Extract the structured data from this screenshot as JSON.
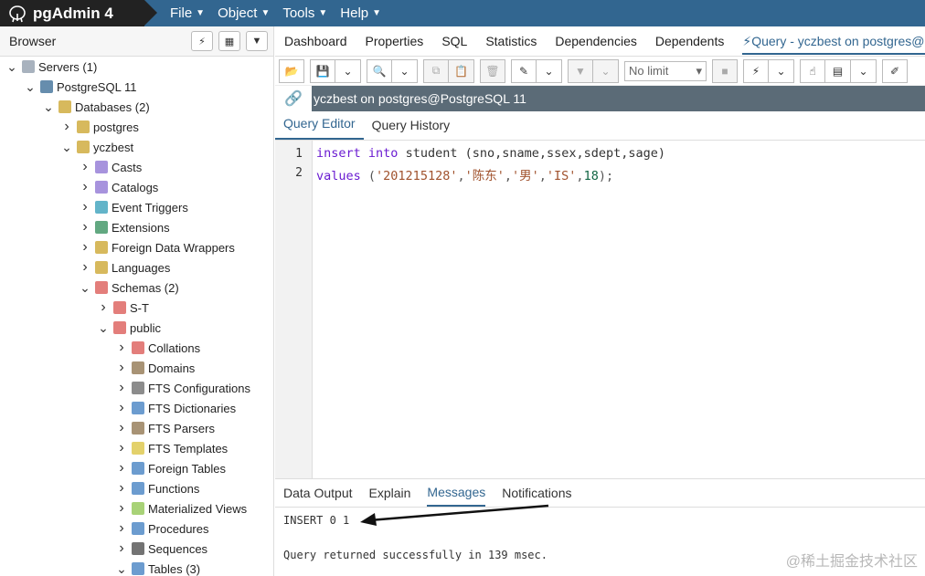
{
  "app": {
    "name": "pgAdmin 4"
  },
  "menu": [
    {
      "label": "File"
    },
    {
      "label": "Object"
    },
    {
      "label": "Tools"
    },
    {
      "label": "Help"
    }
  ],
  "browser": {
    "title": "Browser",
    "tree": [
      {
        "label": "Servers (1)",
        "expanded": true,
        "icon": "servers-icon"
      },
      {
        "label": "PostgreSQL 11",
        "expanded": true,
        "icon": "elephant-icon"
      },
      {
        "label": "Databases (2)",
        "expanded": true,
        "icon": "databases-icon"
      },
      {
        "label": "postgres",
        "expanded": false,
        "icon": "database-icon"
      },
      {
        "label": "yczbest",
        "expanded": true,
        "icon": "database-icon"
      },
      {
        "label": "Casts",
        "expanded": false,
        "icon": "casts-icon"
      },
      {
        "label": "Catalogs",
        "expanded": false,
        "icon": "catalogs-icon"
      },
      {
        "label": "Event Triggers",
        "expanded": false,
        "icon": "event-triggers-icon"
      },
      {
        "label": "Extensions",
        "expanded": false,
        "icon": "extensions-icon"
      },
      {
        "label": "Foreign Data Wrappers",
        "expanded": false,
        "icon": "fdw-icon"
      },
      {
        "label": "Languages",
        "expanded": false,
        "icon": "languages-icon"
      },
      {
        "label": "Schemas (2)",
        "expanded": true,
        "icon": "schemas-icon"
      },
      {
        "label": "S-T",
        "expanded": false,
        "icon": "schema-icon"
      },
      {
        "label": "public",
        "expanded": true,
        "icon": "schema-icon"
      },
      {
        "label": "Collations",
        "expanded": false,
        "icon": "collations-icon"
      },
      {
        "label": "Domains",
        "expanded": false,
        "icon": "domains-icon"
      },
      {
        "label": "FTS Configurations",
        "expanded": false,
        "icon": "fts-config-icon"
      },
      {
        "label": "FTS Dictionaries",
        "expanded": false,
        "icon": "fts-dict-icon"
      },
      {
        "label": "FTS Parsers",
        "expanded": false,
        "icon": "fts-parser-icon"
      },
      {
        "label": "FTS Templates",
        "expanded": false,
        "icon": "fts-template-icon"
      },
      {
        "label": "Foreign Tables",
        "expanded": false,
        "icon": "foreign-tables-icon"
      },
      {
        "label": "Functions",
        "expanded": false,
        "icon": "functions-icon"
      },
      {
        "label": "Materialized Views",
        "expanded": false,
        "icon": "mat-views-icon"
      },
      {
        "label": "Procedures",
        "expanded": false,
        "icon": "procedures-icon"
      },
      {
        "label": "Sequences",
        "expanded": false,
        "icon": "sequences-icon"
      },
      {
        "label": "Tables (3)",
        "expanded": true,
        "icon": "tables-icon"
      }
    ]
  },
  "tabs": [
    {
      "label": "Dashboard"
    },
    {
      "label": "Properties"
    },
    {
      "label": "SQL"
    },
    {
      "label": "Statistics"
    },
    {
      "label": "Dependencies"
    },
    {
      "label": "Dependents"
    },
    {
      "label": "Query - yczbest on postgres@P"
    }
  ],
  "toolbar": {
    "limit_value": "No limit"
  },
  "connection": {
    "label": "yczbest on postgres@PostgreSQL 11"
  },
  "query_tabs": [
    {
      "label": "Query Editor"
    },
    {
      "label": "Query History"
    }
  ],
  "editor": {
    "line_numbers": [
      "1",
      "2"
    ],
    "line1": {
      "kw1": "insert",
      "kw2": "into",
      "rest": " student (sno,sname,ssex,sdept,sage)"
    },
    "line2": {
      "kw": "values",
      "open": " (",
      "s1": "'201215128'",
      "c1": ",",
      "s2": "'陈东'",
      "c2": ",",
      "s3": "'男'",
      "c3": ",",
      "s4": "'IS'",
      "c4": ",",
      "n": "18",
      "close": ");"
    }
  },
  "result_tabs": [
    {
      "label": "Data Output"
    },
    {
      "label": "Explain"
    },
    {
      "label": "Messages"
    },
    {
      "label": "Notifications"
    }
  ],
  "messages": {
    "line1": "INSERT 0 1",
    "line2": "Query returned successfully in 139 msec."
  },
  "watermark": "@稀土掘金技术社区"
}
